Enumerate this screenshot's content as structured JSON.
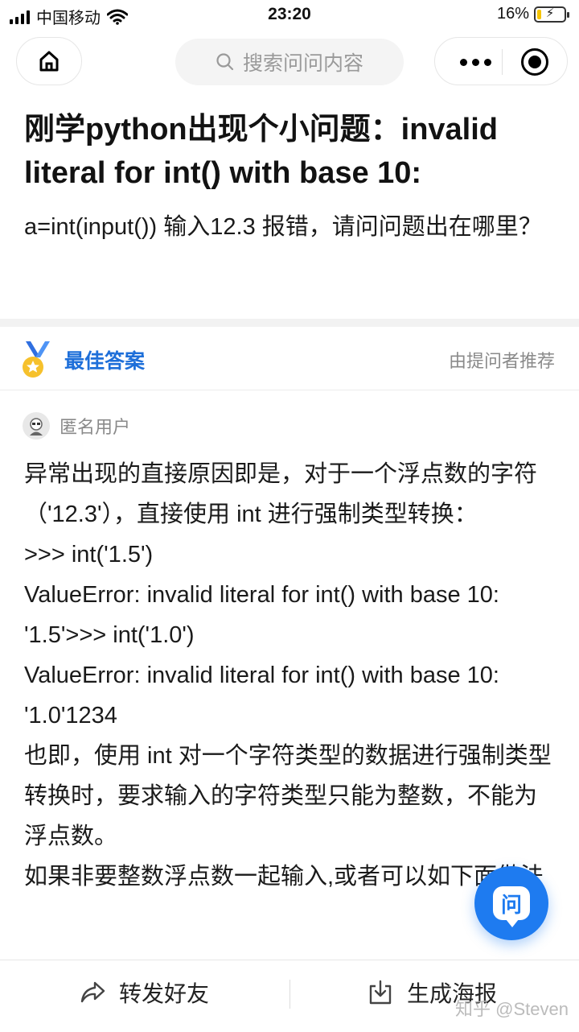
{
  "status_bar": {
    "carrier": "中国移动",
    "time": "23:20",
    "battery_percent": "16%",
    "battery_level": 0.16,
    "icons": [
      "signal-icon",
      "wifi-icon",
      "battery-charging-icon"
    ]
  },
  "nav": {
    "search_placeholder": "搜索问问内容",
    "icons": [
      "home-icon",
      "search-icon",
      "more-icon",
      "close-target-icon"
    ]
  },
  "question": {
    "title": "刚学python出现个小问题：invalid literal for int() with base 10:",
    "description": "a=int(input()) 输入12.3 报错，请问问题出在哪里？"
  },
  "best_answer": {
    "label": "最佳答案",
    "recommended_by": "由提问者推荐",
    "author": "匿名用户",
    "paragraphs": [
      "异常出现的直接原因即是，对于一个浮点数的字符（'12.3'），直接使用 int 进行强制类型转换：",
      ">>> int('1.5')",
      "ValueError: invalid literal for int() with base 10: '1.5'>>> int('1.0')",
      "ValueError: invalid literal for int() with base 10: '1.0'1234",
      "也即，使用 int 对一个字符类型的数据进行强制类型转换时，要求输入的字符类型只能为整数，不能为浮点数。",
      "如果非要整数浮点数一起输入,或者可以如下面做法"
    ]
  },
  "fab": {
    "label": "问"
  },
  "bottom_bar": {
    "share_label": "转发好友",
    "poster_label": "生成海报"
  },
  "watermark": "知乎 @Steven",
  "colors": {
    "accent": "#1e6fd9",
    "fab": "#1e7bf0",
    "battery": "#f5c400"
  }
}
